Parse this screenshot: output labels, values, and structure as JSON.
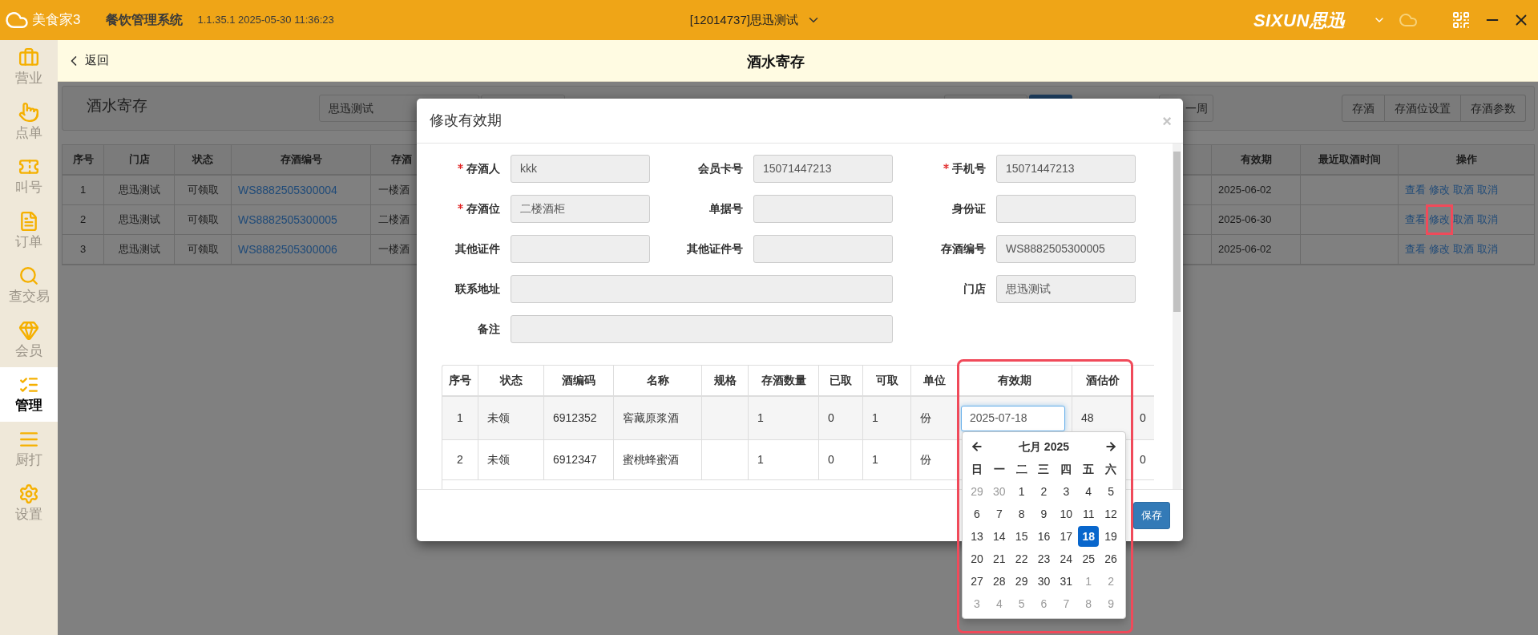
{
  "title_bar": {
    "app_name": "美食家3",
    "system_name": "餐饮管理系统",
    "version": "1.1.35.1 2025-05-30 11:36:23",
    "store": "[12014737]思迅测试",
    "brand_latin": "SIXUN",
    "brand_cn": "思迅"
  },
  "header": {
    "back": "返回",
    "title": "酒水寄存"
  },
  "sidebar": [
    {
      "label": "营业",
      "kind": "briefcase",
      "selected": false
    },
    {
      "label": "点单",
      "kind": "pointer",
      "selected": false
    },
    {
      "label": "叫号",
      "kind": "ticket",
      "selected": false
    },
    {
      "label": "订单",
      "kind": "document",
      "selected": false
    },
    {
      "label": "查交易",
      "kind": "search",
      "selected": false
    },
    {
      "label": "会员",
      "kind": "gem",
      "selected": false
    },
    {
      "label": "管理",
      "kind": "checklist",
      "selected": true
    },
    {
      "label": "厨打",
      "kind": "lines",
      "selected": false
    },
    {
      "label": "设置",
      "kind": "gear",
      "selected": false
    }
  ],
  "page": {
    "title": "酒水寄存",
    "store_filter": "思迅测试",
    "period_button": "一周",
    "actions": [
      "存酒",
      "存酒位设置",
      "存酒参数"
    ],
    "table": {
      "columns_left": [
        "序号",
        "门店",
        "状态",
        "存酒编号",
        "存酒"
      ],
      "columns_right": [
        "有效期",
        "最近取酒时间",
        "操作"
      ],
      "rows": [
        {
          "cells": [
            "1",
            "思迅测试",
            "可领取",
            "WS8882505300004",
            "一楼酒"
          ],
          "expiry": "2025-06-02",
          "actions": [
            {
              "label": "查看",
              "highlighted": false
            },
            {
              "label": "修改",
              "highlighted": false
            },
            {
              "label": "取酒",
              "highlighted": false
            },
            {
              "label": "取消",
              "highlighted": false
            }
          ]
        },
        {
          "cells": [
            "2",
            "思迅测试",
            "可领取",
            "WS8882505300005",
            "二楼酒"
          ],
          "expiry": "2025-06-30",
          "actions": [
            {
              "label": "查看",
              "highlighted": false
            },
            {
              "label": "修改",
              "highlighted": true
            },
            {
              "label": "取酒",
              "highlighted": false
            },
            {
              "label": "取消",
              "highlighted": false
            }
          ]
        },
        {
          "cells": [
            "3",
            "思迅测试",
            "可领取",
            "WS8882505300006",
            "一楼酒"
          ],
          "expiry": "2025-06-02",
          "actions": [
            {
              "label": "查看",
              "highlighted": false
            },
            {
              "label": "修改",
              "highlighted": false
            },
            {
              "label": "取酒",
              "highlighted": false
            },
            {
              "label": "取消",
              "highlighted": false
            }
          ]
        }
      ]
    }
  },
  "dialog": {
    "title": "修改有效期",
    "close": "×",
    "fields": [
      {
        "label": "存酒人",
        "required": true,
        "value": "kkk",
        "wide": false
      },
      {
        "label": "会员卡号",
        "required": false,
        "value": "15071447213",
        "wide": false
      },
      {
        "label": "手机号",
        "required": true,
        "value": "15071447213",
        "wide": false
      },
      {
        "label": "存酒位",
        "required": true,
        "value": "二楼酒柜",
        "wide": false
      },
      {
        "label": "单据号",
        "required": false,
        "wide": false
      },
      {
        "label": "身份证",
        "required": false,
        "wide": false
      },
      {
        "label": "其他证件",
        "required": false,
        "wide": false
      },
      {
        "label": "其他证件号",
        "required": false,
        "wide": false
      },
      {
        "label": "存酒编号",
        "required": false,
        "value": "WS8882505300005",
        "wide": false
      },
      {
        "label": "联系地址",
        "required": false,
        "wide": true
      },
      {
        "label": "门店",
        "required": false,
        "value": "思迅测试",
        "wide": false
      },
      {
        "label": "备注",
        "required": false,
        "wide": true
      }
    ],
    "items": {
      "columns": [
        "序号",
        "状态",
        "酒编码",
        "名称",
        "规格",
        "存酒数量",
        "已取",
        "可取",
        "单位",
        "有效期",
        "酒估价"
      ],
      "rows": [
        {
          "index": "1",
          "status": "未领",
          "code": "6912352",
          "name": "窖藏原浆酒",
          "quantity": "1",
          "taken": "0",
          "available": "1",
          "unit": "份",
          "expiry": "2025-07-18",
          "expiry_focused": true,
          "price": "48",
          "column_12": "0"
        },
        {
          "index": "2",
          "status": "未领",
          "code": "6912347",
          "name": "蜜桃蜂蜜酒",
          "quantity": "1",
          "taken": "0",
          "available": "1",
          "unit": "份",
          "column_12": "0"
        }
      ]
    },
    "expiry_annotation": true,
    "calendar": {
      "month_label": "七月 2025",
      "weekdays": [
        "日",
        "一",
        "二",
        "三",
        "四",
        "五",
        "六"
      ],
      "weeks": [
        [
          {
            "day": "29",
            "outside": true,
            "selected": false
          },
          {
            "day": "30",
            "outside": true,
            "selected": false
          },
          {
            "day": "1",
            "outside": false,
            "selected": false
          },
          {
            "day": "2",
            "outside": false,
            "selected": false
          },
          {
            "day": "3",
            "outside": false,
            "selected": false
          },
          {
            "day": "4",
            "outside": false,
            "selected": false
          },
          {
            "day": "5",
            "outside": false,
            "selected": false
          }
        ],
        [
          {
            "day": "6",
            "outside": false,
            "selected": false
          },
          {
            "day": "7",
            "outside": false,
            "selected": false
          },
          {
            "day": "8",
            "outside": false,
            "selected": false
          },
          {
            "day": "9",
            "outside": false,
            "selected": false
          },
          {
            "day": "10",
            "outside": false,
            "selected": false
          },
          {
            "day": "11",
            "outside": false,
            "selected": false
          },
          {
            "day": "12",
            "outside": false,
            "selected": false
          }
        ],
        [
          {
            "day": "13",
            "outside": false,
            "selected": false
          },
          {
            "day": "14",
            "outside": false,
            "selected": false
          },
          {
            "day": "15",
            "outside": false,
            "selected": false
          },
          {
            "day": "16",
            "outside": false,
            "selected": false
          },
          {
            "day": "17",
            "outside": false,
            "selected": false
          },
          {
            "day": "18",
            "outside": false,
            "selected": true
          },
          {
            "day": "19",
            "outside": false,
            "selected": false
          }
        ],
        [
          {
            "day": "20",
            "outside": false,
            "selected": false
          },
          {
            "day": "21",
            "outside": false,
            "selected": false
          },
          {
            "day": "22",
            "outside": false,
            "selected": false
          },
          {
            "day": "23",
            "outside": false,
            "selected": false
          },
          {
            "day": "24",
            "outside": false,
            "selected": false
          },
          {
            "day": "25",
            "outside": false,
            "selected": false
          },
          {
            "day": "26",
            "outside": false,
            "selected": false
          }
        ],
        [
          {
            "day": "27",
            "outside": false,
            "selected": false
          },
          {
            "day": "28",
            "outside": false,
            "selected": false
          },
          {
            "day": "29",
            "outside": false,
            "selected": false
          },
          {
            "day": "30",
            "outside": false,
            "selected": false
          },
          {
            "day": "31",
            "outside": false,
            "selected": false
          },
          {
            "day": "1",
            "outside": true,
            "selected": false
          },
          {
            "day": "2",
            "outside": true,
            "selected": false
          }
        ],
        [
          {
            "day": "3",
            "outside": true,
            "selected": false
          },
          {
            "day": "4",
            "outside": true,
            "selected": false
          },
          {
            "day": "5",
            "outside": true,
            "selected": false
          },
          {
            "day": "6",
            "outside": true,
            "selected": false
          },
          {
            "day": "7",
            "outside": true,
            "selected": false
          },
          {
            "day": "8",
            "outside": true,
            "selected": false
          },
          {
            "day": "9",
            "outside": true,
            "selected": false
          }
        ]
      ]
    },
    "save_button": "保存"
  }
}
